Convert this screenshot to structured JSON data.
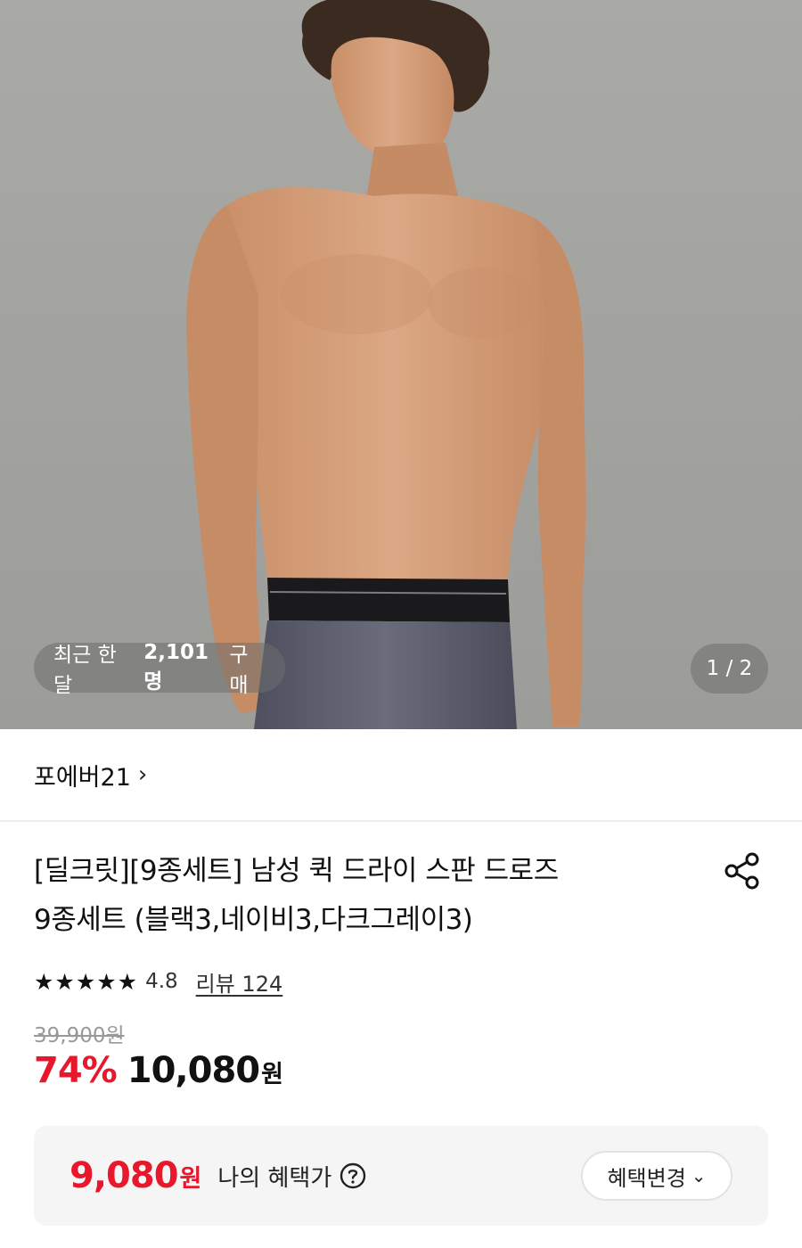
{
  "gallery": {
    "buyers_prefix": "최근 한 달",
    "buyers_count": "2,101명",
    "buyers_suffix": "구매",
    "page_indicator": "1 / 2"
  },
  "brand": {
    "name": "포에버21",
    "chevron": "›"
  },
  "product": {
    "title_line1": "[딜크릿][9종세트] 남성 퀵 드라이 스판 드로즈",
    "title_line2": "9종세트 (블랙3,네이비3,다크그레이3)",
    "stars": "★★★★★",
    "rating": "4.8",
    "review_label": "리뷰 124",
    "original_price": "39,900원",
    "discount": "74%",
    "sale_price": "10,080",
    "sale_currency": "원"
  },
  "benefit": {
    "price": "9,080",
    "currency": "원",
    "label": "나의 혜택가",
    "change_label": "혜택변경",
    "change_chevron": "⌄"
  },
  "colors": {
    "accent_red": "#e8172c",
    "benefit_bg": "#f5f5f5"
  }
}
